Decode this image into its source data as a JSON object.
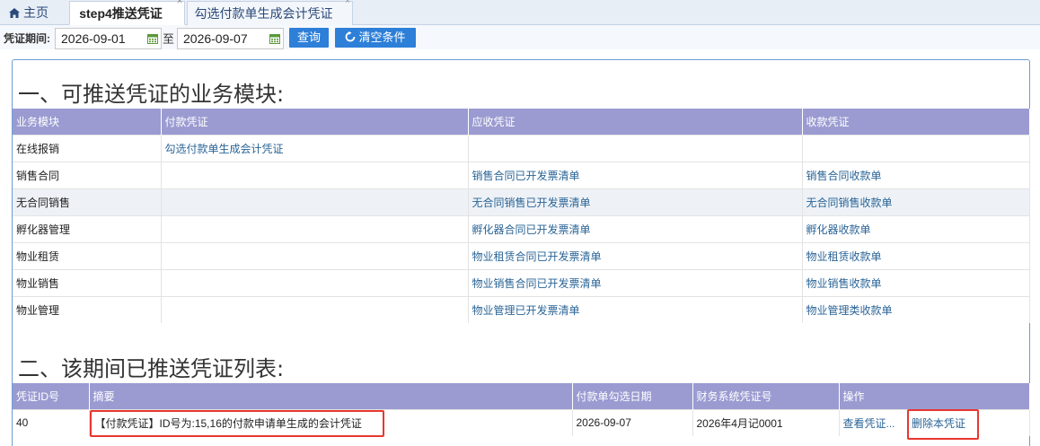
{
  "tabs": {
    "home": "主页",
    "step4": "step4推送凭证",
    "voucher": "勾选付款单生成会计凭证",
    "close": "×"
  },
  "toolbar": {
    "period_label": "凭证期间:",
    "date_from": "2026-09-01",
    "to_label": "至",
    "date_to": "2026-09-07",
    "query_label": "查询",
    "clear_label": "清空条件"
  },
  "section1": {
    "title": "一、可推送凭证的业务模块:",
    "headers": [
      "业务模块",
      "付款凭证",
      "应收凭证",
      "收款凭证"
    ],
    "rows": [
      {
        "module": "在线报销",
        "payment": "勾选付款单生成会计凭证",
        "receivable": "",
        "receipt": ""
      },
      {
        "module": "销售合同",
        "payment": "",
        "receivable": "销售合同已开发票清单",
        "receipt": "销售合同收款单"
      },
      {
        "module": "无合同销售",
        "payment": "",
        "receivable": "无合同销售已开发票清单",
        "receipt": "无合同销售收款单"
      },
      {
        "module": "孵化器管理",
        "payment": "",
        "receivable": "孵化器合同已开发票清单",
        "receipt": "孵化器收款单"
      },
      {
        "module": "物业租赁",
        "payment": "",
        "receivable": "物业租赁合同已开发票清单",
        "receipt": "物业租赁收款单"
      },
      {
        "module": "物业销售",
        "payment": "",
        "receivable": "物业销售合同已开发票清单",
        "receipt": "物业销售收款单"
      },
      {
        "module": "物业管理",
        "payment": "",
        "receivable": "物业管理已开发票清单",
        "receipt": "物业管理类收款单"
      }
    ]
  },
  "section2": {
    "title": "二、该期间已推送凭证列表:",
    "headers": [
      "凭证ID号",
      "摘要",
      "付款单勾选日期",
      "财务系统凭证号",
      "操作"
    ],
    "rows": [
      {
        "id": "40",
        "summary": "【付款凭证】ID号为:15,16的付款申请单生成的会计凭证",
        "date": "2026-09-07",
        "voucher_no": "2026年4月记0001",
        "view": "查看凭证...",
        "delete": "删除本凭证"
      }
    ]
  },
  "colors": {
    "header_bg": "#9b9bd2",
    "link": "#2a6496",
    "button": "#2d7fd8",
    "highlight": "#e8372f"
  }
}
